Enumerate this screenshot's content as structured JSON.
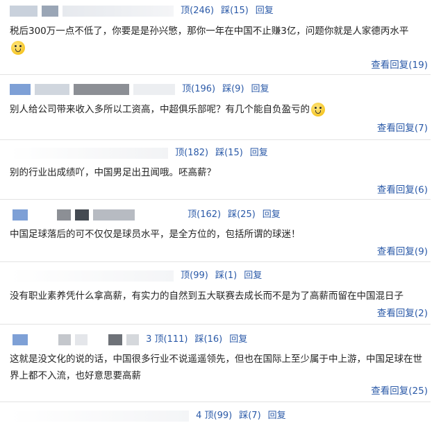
{
  "comments": [
    {
      "up_label": "顶(246)",
      "down_label": "踩(15)",
      "reply_label": "回复",
      "text": "税后300万一点不低了，你要是是孙兴慜，那你一年在中国不止赚3亿，问题你就是人家德丙水平",
      "view_label": "查看回复(19)"
    },
    {
      "up_label": "顶(196)",
      "down_label": "踩(9)",
      "reply_label": "回复",
      "text": "别人给公司带来收入多所以工资高，中超俱乐部呢？有几个能自负盈亏的",
      "view_label": "查看回复(7)"
    },
    {
      "up_label": "顶(182)",
      "down_label": "踩(15)",
      "reply_label": "回复",
      "text": "别的行业出成绩吖，中国男足出丑闻哦。呸高薪？",
      "view_label": "查看回复(6)"
    },
    {
      "up_label": "顶(162)",
      "down_label": "踩(25)",
      "reply_label": "回复",
      "text": "中国足球落后的可不仅仅是球员水平，是全方位的，包括所谓的球迷！",
      "view_label": "查看回复(9)"
    },
    {
      "up_label": "顶(99)",
      "down_label": "踩(1)",
      "reply_label": "回复",
      "text": "没有职业素养凭什么拿高薪，有实力的自然到五大联赛去成长而不是为了高薪而留在中国混日子",
      "view_label": "查看回复(2)"
    },
    {
      "up_label": "3 顶(111)",
      "down_label": "踩(16)",
      "reply_label": "回复",
      "text": "这就是没文化的说的话，中国很多行业不说遥遥领先，但也在国际上至少属于中上游，中国足球在世界上都不入流，也好意思要高薪",
      "view_label": "查看回复(25)"
    },
    {
      "up_label": "4 顶(99)",
      "down_label": "踩(7)",
      "reply_label": "回复",
      "text": "",
      "view_label": ""
    }
  ]
}
